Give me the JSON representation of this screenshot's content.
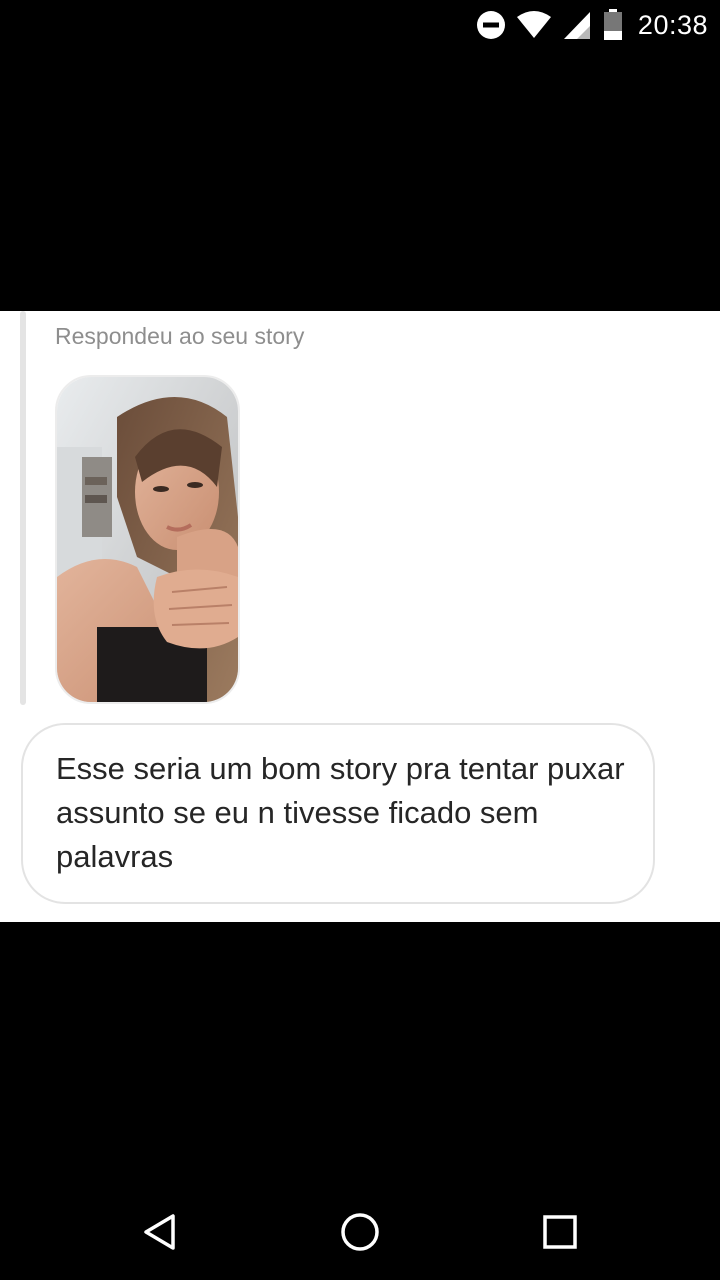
{
  "status_bar": {
    "time": "20:38",
    "icons": [
      "do-not-disturb-icon",
      "wifi-icon",
      "signal-icon",
      "battery-icon"
    ]
  },
  "conversation": {
    "reply_label": "Respondeu ao seu story",
    "story_thumbnail": "story-photo",
    "message": "Esse seria um bom story pra tentar puxar assunto se eu n tivesse ficado sem palavras"
  },
  "nav_bar": {
    "buttons": [
      "back-icon",
      "home-icon",
      "recents-icon"
    ]
  },
  "colors": {
    "background": "#000000",
    "panel": "#ffffff",
    "secondary_text": "#8e8e8e",
    "message_text": "#262626",
    "bubble_border": "#e3e3e3"
  }
}
